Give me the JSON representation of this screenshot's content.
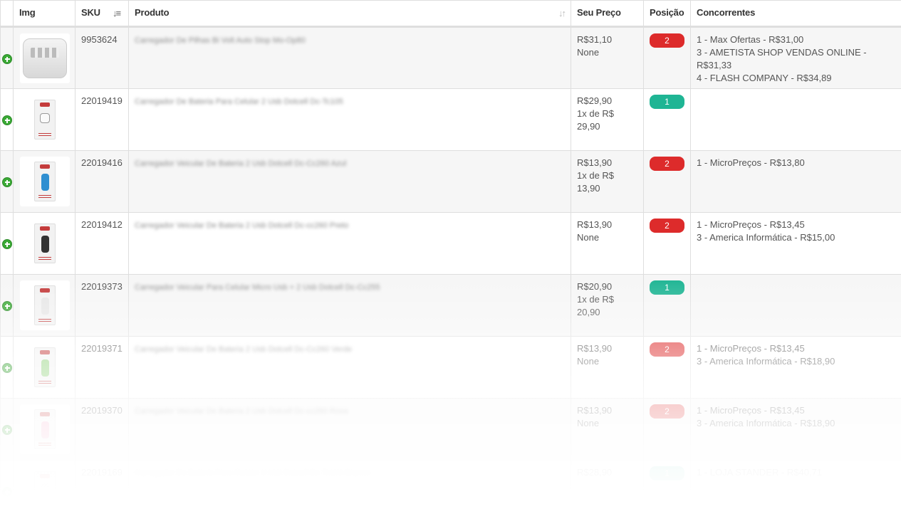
{
  "table": {
    "headers": {
      "img": "Img",
      "sku": "SKU",
      "produto": "Produto",
      "preco": "Seu Preço",
      "posicao": "Posição",
      "concorrentes": "Concorrentes"
    },
    "sort_icons": {
      "sku": "sort-desc-icon",
      "produto": "sort-icon"
    },
    "rows": [
      {
        "sku": "9953624",
        "produto": "Carregador De Pilhas Bi Volt Auto Stop Mo-Op80",
        "preco": "R$31,10",
        "preco_extra": "None",
        "posicao": "2",
        "badge_color": "#dd2b2b",
        "concorrentes": [
          "1 - Max Ofertas - R$31,00",
          "3 - AMETISTA SHOP VENDAS ONLINE - R$31,33",
          "4 - FLASH COMPANY - R$34,89"
        ],
        "thumb": "wall-charger-image"
      },
      {
        "sku": "22019419",
        "produto": "Carregador De Bateria Para Celular 2 Usb Dotcell Dc-Tc105",
        "preco": "R$29,90",
        "preco_extra": "1x de R$ 29,90",
        "posicao": "1",
        "badge_color": "#1fb594",
        "concorrentes": [],
        "thumb": "charger-package-image"
      },
      {
        "sku": "22019416",
        "produto": "Carregador Veicular De Bateria 2 Usb Dotcell Dc-Cc260 Azul",
        "preco": "R$13,90",
        "preco_extra": "1x de R$ 13,90",
        "posicao": "2",
        "badge_color": "#dd2b2b",
        "concorrentes": [
          "1 - MicroPreços - R$13,80"
        ],
        "thumb": "car-charger-blue-image"
      },
      {
        "sku": "22019412",
        "produto": "Carregador Veicular De Bateria 2 Usb Dotcell Dc-cc260 Preto",
        "preco": "R$13,90",
        "preco_extra": "None",
        "posicao": "2",
        "badge_color": "#dd2b2b",
        "concorrentes": [
          "1 - MicroPreços - R$13,45",
          "3 - America Informática - R$15,00"
        ],
        "thumb": "car-charger-black-image"
      },
      {
        "sku": "22019373",
        "produto": "Carregador Veicular Para Celular Micro Usb + 2 Usb Dotcell Dc-Cc255",
        "preco": "R$20,90",
        "preco_extra": "1x de R$ 20,90",
        "posicao": "1",
        "badge_color": "#1fb594",
        "concorrentes": [],
        "thumb": "car-charger-white-image"
      },
      {
        "sku": "22019371",
        "produto": "Carregador Veicular De Bateria 2 Usb Dotcell Dc-Cc260 Verde",
        "preco": "R$13,90",
        "preco_extra": "None",
        "posicao": "2",
        "badge_color": "#dd2b2b",
        "concorrentes": [
          "1 - MicroPreços - R$13,45",
          "3 - America Informática - R$18,90"
        ],
        "thumb": "car-charger-green-image"
      },
      {
        "sku": "22019370",
        "produto": "Carregador Veicular De Bateria 2 Usb Dotcell Dc-cc260 Rosa",
        "preco": "R$13,90",
        "preco_extra": "None",
        "posicao": "2",
        "badge_color": "#dd2b2b",
        "concorrentes": [
          "1 - MicroPreços - R$13,45",
          "3 - America Informática - R$18,90"
        ],
        "thumb": "car-charger-pink-image"
      },
      {
        "sku": "22019169",
        "produto": "Carregador De Bateria Para Celular 3 Usb Dotcell Dc-Tc100 Branco",
        "preco": "R$28,90",
        "preco_extra": "",
        "posicao": "1",
        "badge_color": "#1fb594",
        "concorrentes": [
          "1 - LOJA STANDER - R$40,71"
        ],
        "thumb": "charger-white-image"
      }
    ]
  },
  "thumb_colors": [
    "#d8d8d8",
    "#c43c3c",
    "#2f8fd1",
    "#333333",
    "#e6e6e6",
    "#8fd17a",
    "#f2a9c4",
    "#e6e6e6"
  ]
}
